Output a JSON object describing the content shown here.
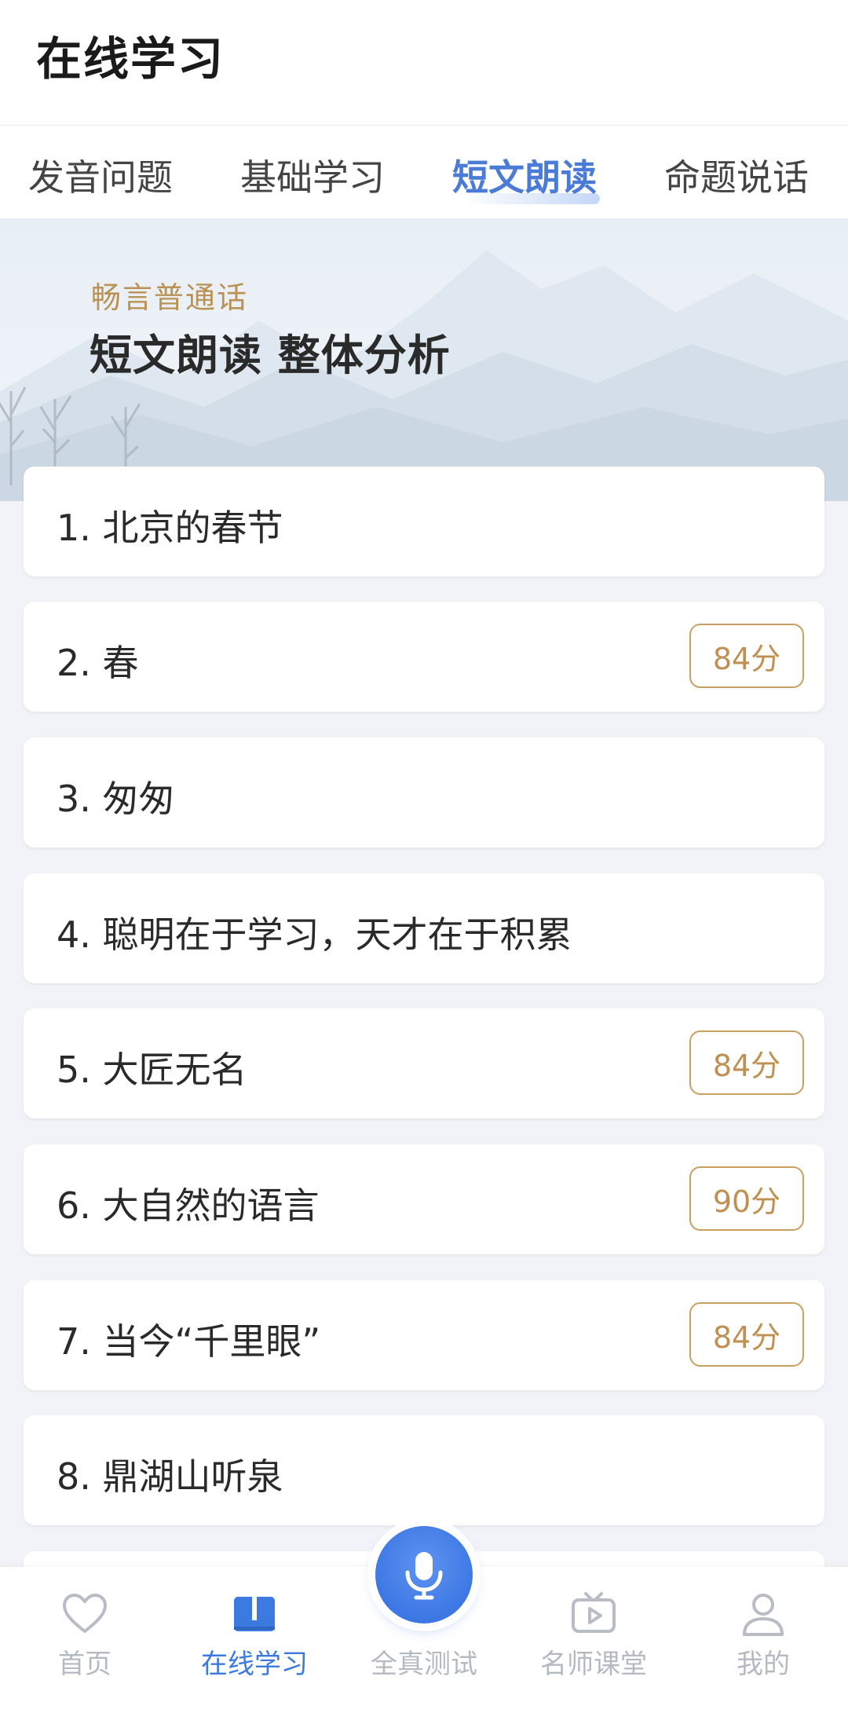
{
  "header": {
    "title": "在线学习"
  },
  "tabs": [
    {
      "label": "发音问题"
    },
    {
      "label": "基础学习"
    },
    {
      "label": "短文朗读"
    },
    {
      "label": "命题说话"
    }
  ],
  "active_tab": "短文朗读",
  "banner": {
    "subtitle": "畅言普通话",
    "title": "短文朗读 整体分析"
  },
  "items": [
    {
      "label": "1. 北京的春节",
      "score": ""
    },
    {
      "label": "2. 春",
      "score": "84分"
    },
    {
      "label": "3. 匆匆",
      "score": ""
    },
    {
      "label": "4. 聪明在于学习，天才在于积累",
      "score": ""
    },
    {
      "label": "5. 大匠无名",
      "score": "84分"
    },
    {
      "label": "6. 大自然的语言",
      "score": "90分"
    },
    {
      "label": "7. 当今“千里眼”",
      "score": "84分"
    },
    {
      "label": "8. 鼎湖山听泉",
      "score": ""
    }
  ],
  "tabbar": {
    "items": [
      {
        "label": "首页",
        "icon": "heart-icon"
      },
      {
        "label": "在线学习",
        "icon": "book-icon"
      },
      {
        "label": "全真测试",
        "icon": "microphone-icon"
      },
      {
        "label": "名师课堂",
        "icon": "tv-play-icon"
      },
      {
        "label": "我的",
        "icon": "user-icon"
      }
    ],
    "active": "在线学习"
  },
  "colors": {
    "accent": "#3c7ae0",
    "score_gold": "#c09052",
    "banner_gold": "#b99254"
  }
}
